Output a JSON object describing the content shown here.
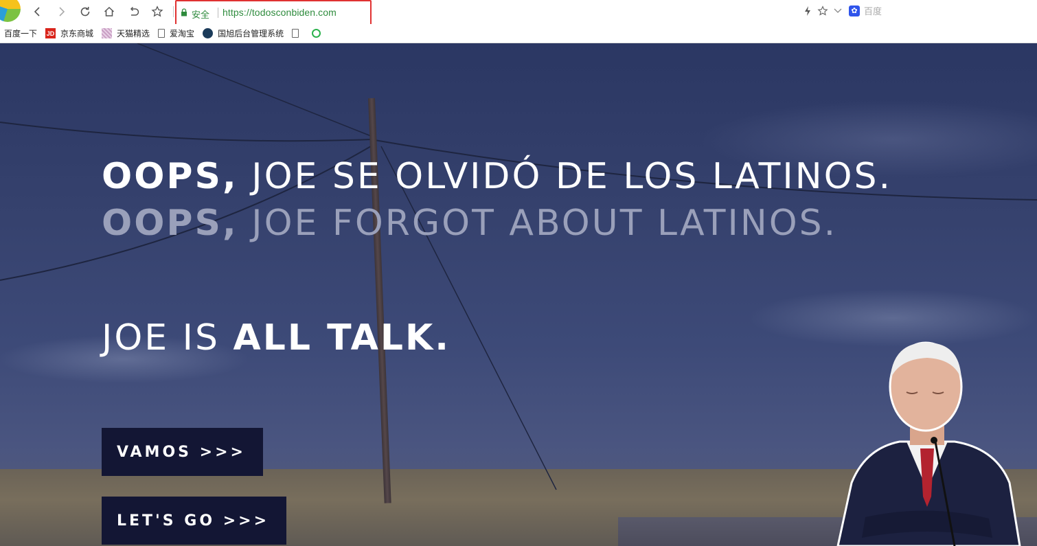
{
  "browser": {
    "secure_label": "安全",
    "url": "https://todosconbiden.com",
    "search_engine": "百度"
  },
  "bookmarks": [
    {
      "label": "百度一下",
      "icon": "none"
    },
    {
      "label": "京东商城",
      "icon": "jd-icon"
    },
    {
      "label": "天猫精选",
      "icon": "tmall-icon"
    },
    {
      "label": "爱淘宝",
      "icon": "file-icon"
    },
    {
      "label": "国旭后台管理系统",
      "icon": "gx-icon"
    },
    {
      "label": "",
      "icon": "file-icon"
    },
    {
      "label": "",
      "icon": "download-icon"
    }
  ],
  "hero": {
    "line1_bold": "OOPS,",
    "line1_light": " JOE SE OLVIDÓ DE LOS LATINOS.",
    "line2_bold": "OOPS,",
    "line2_light": " JOE FORGOT ABOUT LATINOS.",
    "line3_light": "JOE IS ",
    "line3_bold": "ALL TALK.",
    "cta_spanish": "VAMOS >>>",
    "cta_english": "LET'S GO >>>"
  },
  "colors": {
    "address_highlight": "#e03131",
    "secure_green": "#2e8b3d",
    "cta_background": "#131634",
    "sky": "#36426e"
  }
}
